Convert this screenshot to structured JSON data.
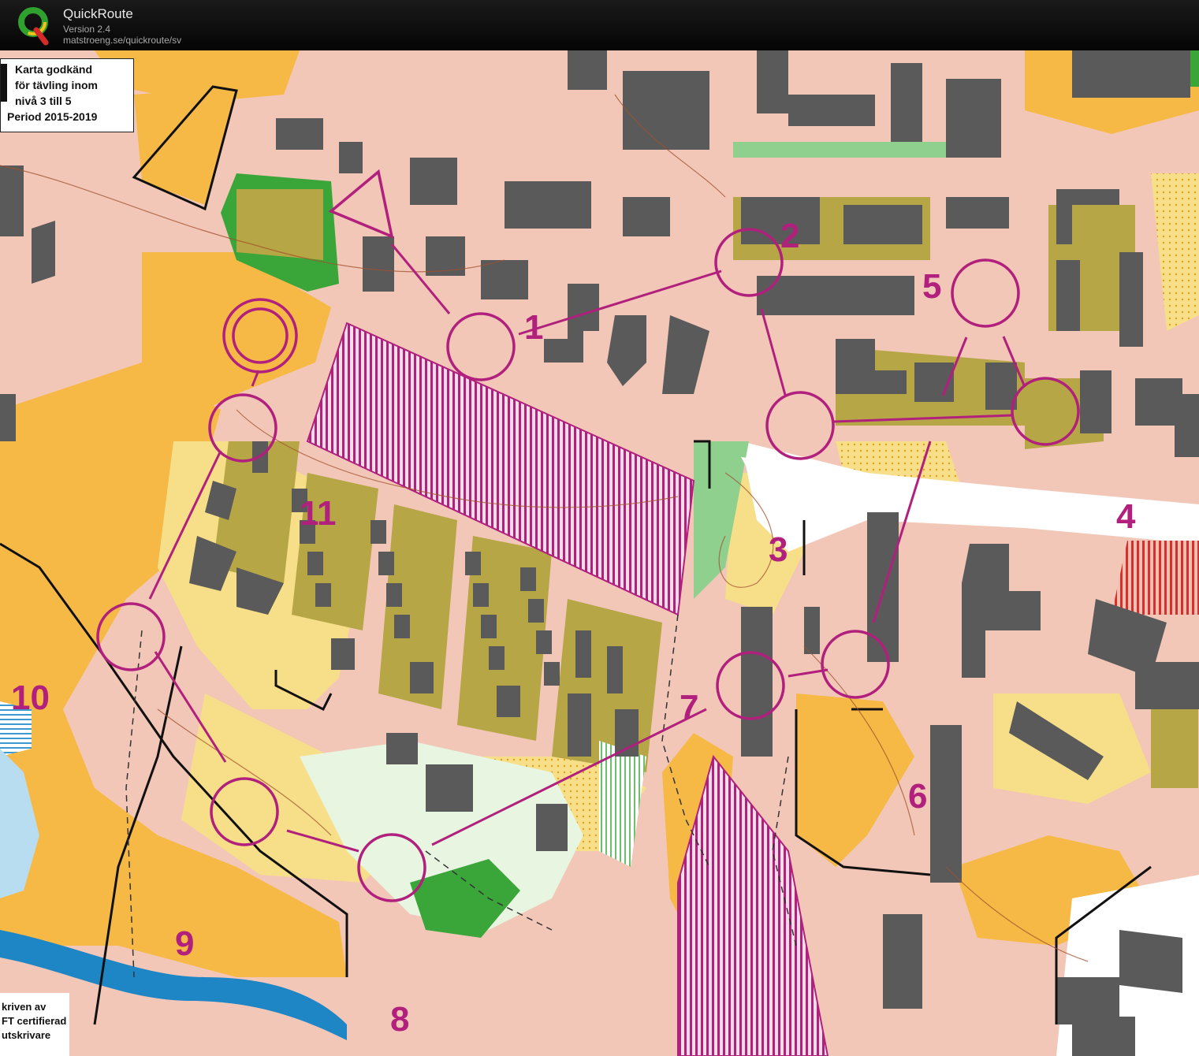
{
  "app": {
    "title": "QuickRoute",
    "version": "Version 2.4",
    "url": "matstroeng.se/quickroute/sv"
  },
  "map": {
    "approval_box": {
      "lines": [
        "Karta godkänd",
        "för tävling inom",
        "nivå 3 till 5",
        "Period 2015-2019"
      ]
    },
    "issuer_box": {
      "lines": [
        "kriven av",
        "FT certifierad",
        "utskrivare"
      ]
    },
    "controls": [
      {
        "label": "1"
      },
      {
        "label": "2"
      },
      {
        "label": "3"
      },
      {
        "label": "4"
      },
      {
        "label": "5"
      },
      {
        "label": "6"
      },
      {
        "label": "7"
      },
      {
        "label": "8"
      },
      {
        "label": "9"
      },
      {
        "label": "10"
      },
      {
        "label": "11"
      }
    ],
    "colors": {
      "course": "#b0207c",
      "building": "#5a5a5a",
      "paved": "#f2c7b8",
      "open_land": "#f6b945",
      "rough_open": "#f7de88",
      "forest": "#ffffff",
      "vegetation_green": "#3aa63a",
      "olive_private": "#b6a645",
      "water": "#1e86c4",
      "out_of_bounds": "#b0207c"
    }
  }
}
